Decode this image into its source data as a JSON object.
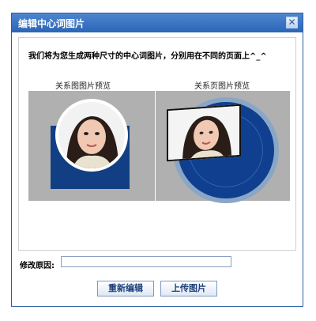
{
  "dialog": {
    "title": "编辑中心词图片",
    "close_glyph": "✕",
    "notice": "我们将为您生成两种尺寸的中心词图片，分别用在不同的页面上^_^",
    "previews": {
      "relation_map_caption": "关系图图片预览",
      "relation_page_caption": "关系页图片预览"
    },
    "reason_label": "修改原因:",
    "reason_value": "",
    "buttons": {
      "reedit": "重新编辑",
      "upload": "上传图片"
    }
  },
  "colors": {
    "title_bar": "#2b65b6",
    "panel_bg": "#b0b0b0",
    "accent_blue": "#123f84"
  }
}
